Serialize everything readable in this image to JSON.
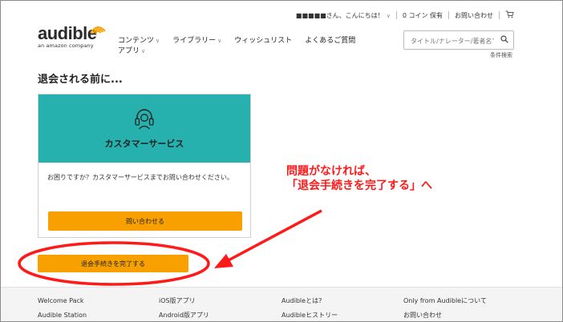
{
  "header": {
    "greeting": "■■■■■さん、こんにちは！",
    "coins": "0 コイン 保有",
    "contact": "お問い合わせ"
  },
  "logo": {
    "word": "audible",
    "sub": "an amazon company"
  },
  "nav": {
    "items": [
      "コンテンツ",
      "ライブラリー",
      "ウィッシュリスト",
      "よくあるご質問"
    ],
    "sub_item": "アプリ"
  },
  "search": {
    "placeholder": "タイトル/ナレーター/著者名で",
    "advanced": "条件検索"
  },
  "page": {
    "title": "退会される前に..."
  },
  "card": {
    "title": "カスタマーサービス",
    "body": "お困りですか？カスタマーサービスまでお問い合わせください。",
    "button": "問い合わせる"
  },
  "complete_button": "退会手続きを完了する",
  "annotation": {
    "line1": "問題がなければ、",
    "line2": "「退会手続きを完了する」へ"
  },
  "footer": {
    "col1": [
      "Welcome Pack",
      "Audible Station"
    ],
    "col2": [
      "iOS版アプリ",
      "Android版アプリ"
    ],
    "col3": [
      "Audibleとは?",
      "Audibleヒストリー"
    ],
    "col4": [
      "Only from Audibleについて",
      "お問い合わせ"
    ]
  },
  "colors": {
    "teal": "#26b1ae",
    "button": "#f7a000",
    "annotation": "#ff1a1a",
    "logo_accent": "#f7a000"
  }
}
